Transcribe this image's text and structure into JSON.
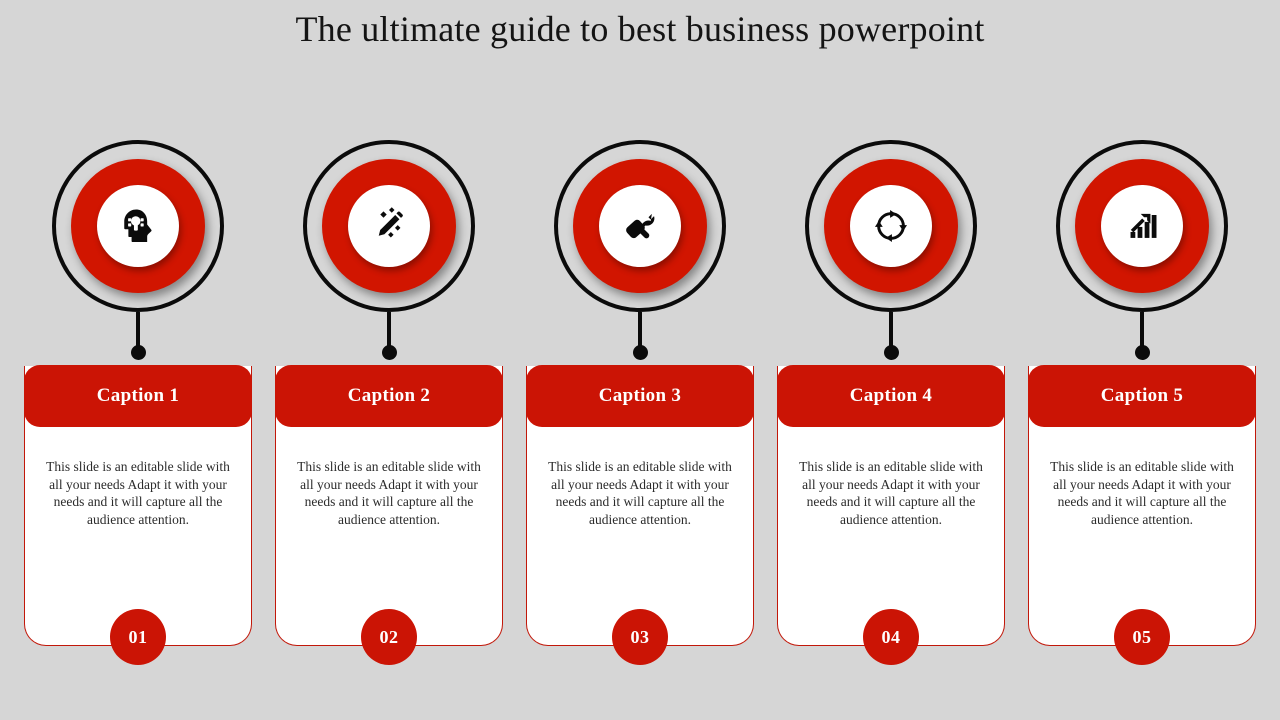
{
  "slide": {
    "title": "The ultimate guide to best business powerpoint",
    "background_color": "#d6d6d6",
    "accent_red": "#cb1405",
    "ring_red": "#d11500",
    "outline_black": "#0b0b0b",
    "card_background": "#ffffff"
  },
  "items": [
    {
      "icon": "head-lightbulb-icon",
      "caption": "Caption 1",
      "body": "This slide is an editable slide with all your needs Adapt it with your needs and it will capture all the audience attention.",
      "number": "01"
    },
    {
      "icon": "pencil-sparkle-icon",
      "caption": "Caption 2",
      "body": "This slide is an editable slide with all your needs Adapt it with your needs and it will capture all the audience attention.",
      "number": "02"
    },
    {
      "icon": "wrench-tool-icon",
      "caption": "Caption 3",
      "body": "This slide is an editable slide with all your needs Adapt it with your needs and it will capture all the audience attention.",
      "number": "03"
    },
    {
      "icon": "refresh-cycle-icon",
      "caption": "Caption 4",
      "body": "This slide is an editable slide with all your needs Adapt it with your needs and it will capture all the audience attention.",
      "number": "04"
    },
    {
      "icon": "growth-chart-icon",
      "caption": "Caption 5",
      "body": "This slide is an editable slide with all your needs Adapt it with your needs and it will capture all the audience attention.",
      "number": "05"
    }
  ]
}
